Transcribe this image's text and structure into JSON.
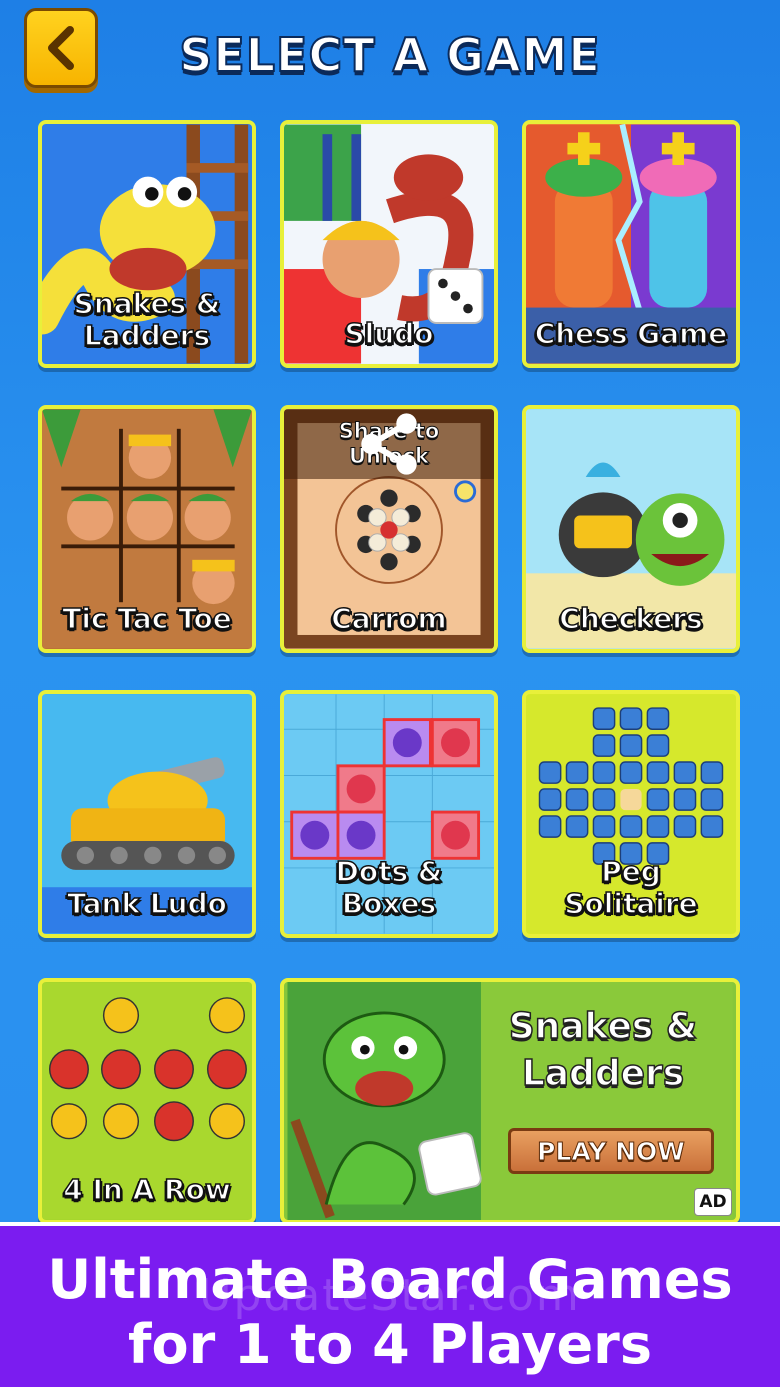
{
  "header": {
    "title": "SELECT A GAME",
    "back_icon": "chevron-left-icon"
  },
  "games": [
    {
      "label_line1": "Snakes &",
      "label_line2": "Ladders",
      "bg": "#2f7de8"
    },
    {
      "label": "Sludo",
      "bg": "#e9f4ff"
    },
    {
      "label": "Chess Game",
      "bg": "#f39a36"
    },
    {
      "label": "Tic Tac Toe",
      "bg": "#b96a33"
    },
    {
      "label": "Carrom",
      "share_line1": "Share to",
      "share_line2": "Unlock",
      "share_icon": "share-icon",
      "bg": "#f0b98a"
    },
    {
      "label": "Checkers",
      "bg": "#9be0f5"
    },
    {
      "label": "Tank Ludo",
      "bg": "#3fb4ef"
    },
    {
      "label": "Dots & Boxes",
      "bg": "#5fc3f2"
    },
    {
      "label": "Peg Solitaire",
      "bg": "#d9ea2a"
    },
    {
      "label": "4 In A Row",
      "bg": "#a4d62c"
    }
  ],
  "ad": {
    "title_line1": "Snakes &",
    "title_line2": "Ladders",
    "cta": "PLAY NOW",
    "badge": "AD"
  },
  "banner": {
    "line1": "Ultimate Board Games",
    "line2": "for 1 to 4 Players"
  },
  "watermark": "UpdateStar.com"
}
